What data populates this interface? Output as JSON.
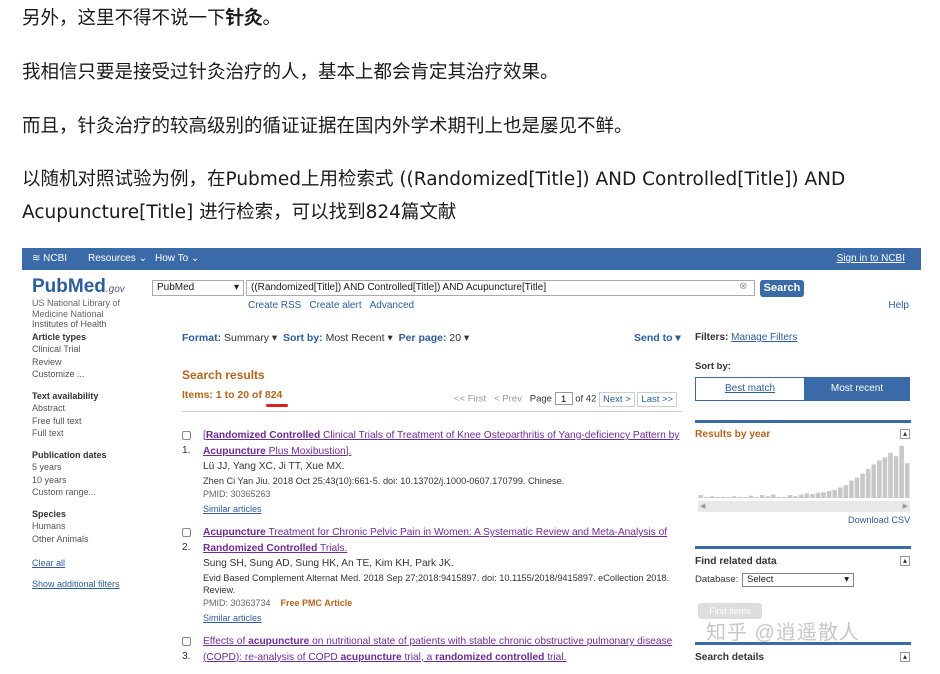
{
  "article": {
    "p1_prefix": "另外，这里不得不说一下",
    "p1_bold": "针灸",
    "p1_suffix": "。",
    "p2": "我相信只要是接受过针灸治疗的人，基本上都会肯定其治疗效果。",
    "p3": "而且，针灸治疗的较高级别的循证证据在国内外学术期刊上也是屡见不鲜。",
    "p4": "以随机对照试验为例，在Pubmed上用检索式 ((Randomized[Title]) AND Controlled[Title]) AND Acupuncture[Title] 进行检索，可以找到824篇文献"
  },
  "ncbi_bar": {
    "logo": "NCBI",
    "resources": "Resources",
    "howto": "How To",
    "signin": "Sign in to NCBI"
  },
  "header": {
    "logo_pub": "Pub",
    "logo_med": "Med",
    "logo_gov": ".gov",
    "lib1": "US National Library of",
    "lib2": "Medicine National",
    "lib3": "Institutes of Health",
    "db_value": "PubMed",
    "query": "((Randomized[Title]) AND Controlled[Title]) AND Acupuncture[Title]",
    "search_btn": "Search",
    "create_rss": "Create RSS",
    "create_alert": "Create alert",
    "advanced": "Advanced",
    "help": "Help"
  },
  "sidebar": {
    "article_types": "Article types",
    "clinical_trial": "Clinical Trial",
    "review": "Review",
    "customize": "Customize ...",
    "text_availability": "Text availability",
    "abstract": "Abstract",
    "free_full_text": "Free full text",
    "full_text": "Full text",
    "pub_dates": "Publication dates",
    "y5": "5 years",
    "y10": "10 years",
    "custom_range": "Custom range...",
    "species": "Species",
    "humans": "Humans",
    "other_animals": "Other Animals",
    "clear_all": "Clear all",
    "show_filters": "Show additional filters"
  },
  "toolbar": {
    "format_label": "Format:",
    "format_value": "Summary",
    "sortby_label": "Sort by:",
    "sortby_value": "Most Recent",
    "perpage_label": "Per page:",
    "perpage_value": "20",
    "send_to": "Send to"
  },
  "results": {
    "heading": "Search results",
    "items_prefix": "Items: 1 to 20 of ",
    "items_total": "824",
    "pager_first": "<< First",
    "pager_prev": "< Prev",
    "page_label": "Page",
    "page_value": "1",
    "page_of": "of 42",
    "pager_next": "Next >",
    "pager_last": "Last >>"
  },
  "items": [
    {
      "num": "1.",
      "t1b": "Randomized Controlled",
      "t2": " Clinical Trials of Treatment of Knee Osteoarthritis of Yang-deficiency Pattern by ",
      "t3b": "Acupuncture",
      "t4": " Plus Moxibustion].",
      "authors": "Lü JJ, Yang XC, Ji TT, Xue MX.",
      "citation": "Zhen Ci Yan Jiu. 2018 Oct 25;43(10):661-5. doi: 10.13702/j.1000-0607.170799. Chinese.",
      "pmid": "PMID: 30365263",
      "pmc": "",
      "similar": "Similar articles"
    },
    {
      "num": "2.",
      "t1b": "Acupuncture",
      "t2": " Treatment for Chronic Pelvic Pain in Women: A Systematic Review and Meta-Analysis of ",
      "t3b": "Randomized Controlled",
      "t4": " Trials.",
      "authors": "Sung SH, Sung AD, Sung HK, An TE, Kim KH, Park JK.",
      "citation": "Evid Based Complement Alternat Med. 2018 Sep 27;2018:9415897. doi: 10.1155/2018/9415897. eCollection 2018. Review.",
      "pmid": "PMID: 30363734",
      "pmc": "Free PMC Article",
      "similar": "Similar articles"
    },
    {
      "num": "3.",
      "t1": "Effects of ",
      "t1b": "acupuncture",
      "t2": " on nutritional state of patients with stable chronic obstructive pulmonary disease (COPD): re-analysis of COPD ",
      "t3b": "acupuncture",
      "t4": " trial, a ",
      "t5b": "randomized controlled",
      "t6": " trial."
    }
  ],
  "right": {
    "filters_label": "Filters:",
    "manage_filters": "Manage Filters",
    "sort_by": "Sort by:",
    "best_match": "Best match",
    "most_recent": "Most recent",
    "results_by_year": "Results by year",
    "download_csv": "Download CSV",
    "find_related": "Find related data",
    "database_label": "Database:",
    "database_value": "Select",
    "find_items": "Find items",
    "search_details": "Search details"
  },
  "watermark": "知乎 @逍遥散人",
  "year_bars": [
    0.05,
    0.02,
    0.03,
    0.0,
    0.02,
    0.0,
    0.03,
    0.02,
    0.0,
    0.04,
    0.0,
    0.05,
    0.03,
    0.06,
    0.02,
    0.0,
    0.05,
    0.03,
    0.06,
    0.08,
    0.07,
    0.09,
    0.1,
    0.12,
    0.14,
    0.18,
    0.22,
    0.3,
    0.35,
    0.42,
    0.5,
    0.58,
    0.65,
    0.7,
    0.78,
    0.72,
    0.9,
    0.6
  ],
  "colors": {
    "ncbi_bar": "#3a6aa7",
    "result_title": "#6f2b96",
    "accent_orange": "#b5651d",
    "underline_red": "#e0201a"
  }
}
